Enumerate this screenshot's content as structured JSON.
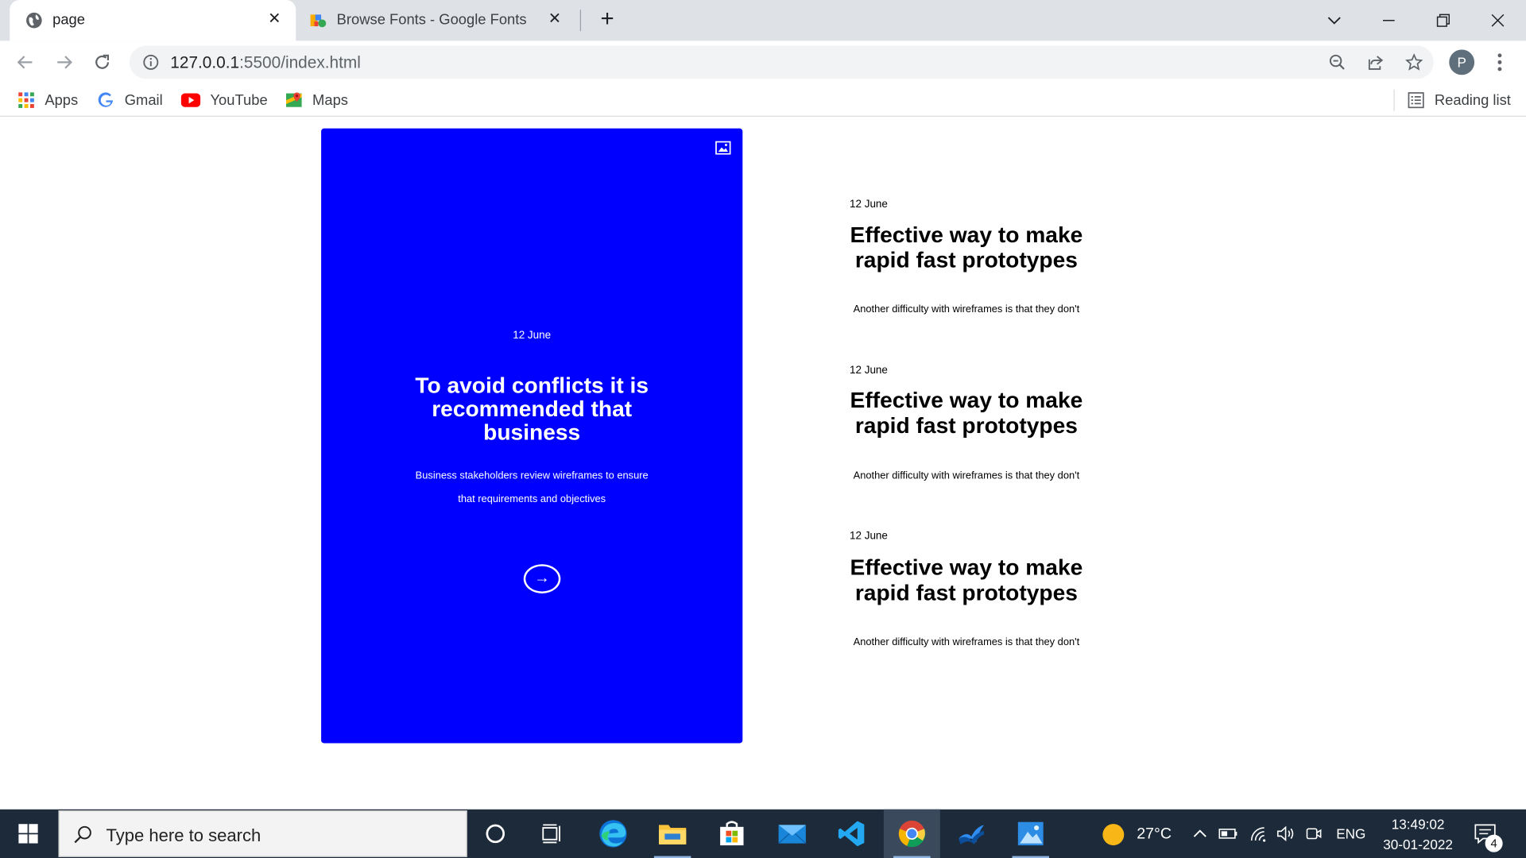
{
  "browser": {
    "tabs": [
      {
        "title": "page",
        "active": true,
        "favicon": "globe-icon"
      },
      {
        "title": "Browse Fonts - Google Fonts",
        "active": false,
        "favicon": "google-fonts-icon"
      }
    ],
    "new_tab_label": "+",
    "address": {
      "host": "127.0.0.1",
      "path": ":5500/index.html"
    },
    "profile_initial": "P",
    "bookmarks": [
      {
        "label": "Apps",
        "icon": "apps-grid-icon"
      },
      {
        "label": "Gmail",
        "icon": "google-g-icon"
      },
      {
        "label": "YouTube",
        "icon": "youtube-icon"
      },
      {
        "label": "Maps",
        "icon": "maps-icon"
      }
    ],
    "reading_list": "Reading list"
  },
  "page": {
    "feature": {
      "date": "12 June",
      "title": "To avoid conflicts it is recommended that business",
      "description": "Business stakeholders review wireframes to ensure that requirements and objectives",
      "arrow": "→",
      "background": "#0000ff"
    },
    "posts": [
      {
        "date": "12 June",
        "title": "Effective way to make rapid fast prototypes",
        "description": "Another difficulty with wireframes is that they don't"
      },
      {
        "date": "12 June",
        "title": "Effective way to make rapid fast prototypes",
        "description": "Another difficulty with wireframes is that they don't"
      },
      {
        "date": "12 June",
        "title": "Effective way to make rapid fast prototypes",
        "description": "Another difficulty with wireframes is that they don't"
      }
    ]
  },
  "taskbar": {
    "search_placeholder": "Type here to search",
    "apps": [
      "cortana-icon",
      "task-view-icon",
      "edge-icon",
      "file-explorer-icon",
      "store-icon",
      "mail-icon",
      "vscode-icon",
      "chrome-icon",
      "app-icon",
      "photos-icon"
    ],
    "weather": "27°C",
    "language": "ENG",
    "time": "13:49:02",
    "date": "30-01-2022",
    "notifications": "4"
  }
}
